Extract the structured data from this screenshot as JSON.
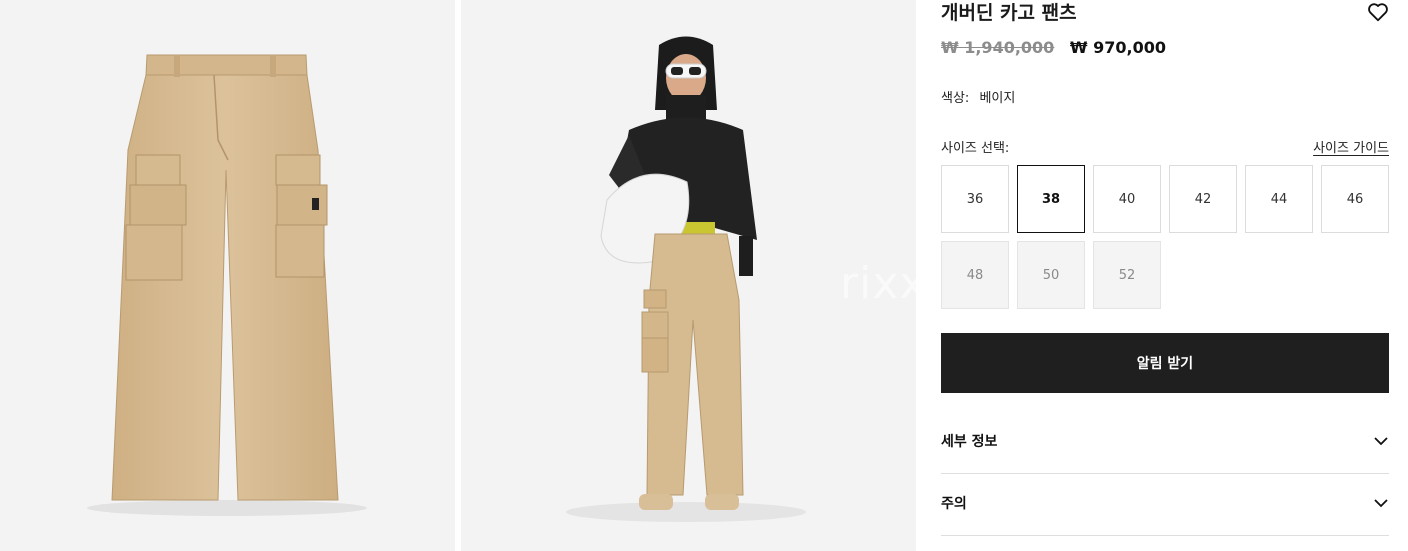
{
  "product": {
    "title": "개버딘 카고 팬츠",
    "original_price": "₩ 1,940,000",
    "sale_price": "₩ 970,000"
  },
  "color": {
    "label": "색상:",
    "value": "베이지"
  },
  "size": {
    "label": "사이즈 선택:",
    "guide_label": "사이즈 가이드",
    "options": [
      "36",
      "38",
      "40",
      "42",
      "44",
      "46",
      "48",
      "50",
      "52"
    ],
    "selected": "38",
    "unavailable": [
      "48",
      "50",
      "52"
    ]
  },
  "actions": {
    "notify_label": "알림 받기"
  },
  "accordions": {
    "details_label": "세부 정보",
    "caution_label": "주의"
  },
  "gallery": {
    "watermark": "rixx"
  },
  "colors": {
    "fabric": "#d8bc93",
    "background": "#f3f3f3",
    "button": "#1f1f1f"
  },
  "icons": {
    "wishlist": "heart-icon",
    "expand": "chevron-down-icon"
  }
}
